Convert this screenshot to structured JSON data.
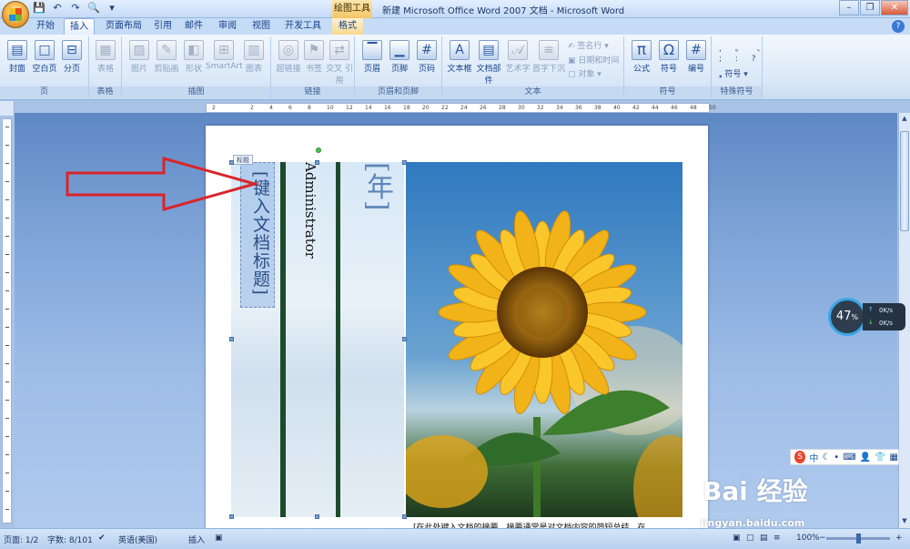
{
  "window": {
    "title": "新建 Microsoft Office Word 2007 文档 - Microsoft Word",
    "context_tab_title": "绘图工具"
  },
  "tabs": [
    {
      "label": "开始"
    },
    {
      "label": "插入",
      "active": true
    },
    {
      "label": "页面布局"
    },
    {
      "label": "引用"
    },
    {
      "label": "邮件"
    },
    {
      "label": "审阅"
    },
    {
      "label": "视图"
    },
    {
      "label": "开发工具"
    },
    {
      "label": "格式"
    }
  ],
  "ribbon": {
    "groups": {
      "page": "页",
      "table": "表格",
      "illustrations": "插图",
      "links": "链接",
      "header_footer": "页眉和页脚",
      "text": "文本",
      "symbols": "符号",
      "special_symbols": "特殊符号"
    },
    "buttons": {
      "cover": "封面",
      "blank_page": "空白页",
      "page_break": "分页",
      "table": "表格",
      "picture": "图片",
      "clip_art": "剪贴画",
      "shapes": "形状",
      "smartart": "SmartArt",
      "chart": "图表",
      "hyperlink": "超链接",
      "bookmark": "书签",
      "cross_ref": "交叉\n引用",
      "header": "页眉",
      "footer": "页脚",
      "page_number": "页码",
      "text_box": "文本框",
      "quick_parts": "文档部件",
      "wordart": "艺术字",
      "drop_cap": "首字下沉",
      "signature_line": "签名行",
      "date_time": "日期和时间",
      "object": "对象",
      "equation": "公式",
      "symbol": "符号",
      "number": "编号",
      "special_symbol": "符号"
    }
  },
  "ruler": {
    "ticks": [
      "2",
      "",
      "2",
      "4",
      "6",
      "8",
      "10",
      "12",
      "14",
      "16",
      "18",
      "20",
      "22",
      "24",
      "26",
      "28",
      "30",
      "32",
      "34",
      "36",
      "38",
      "40",
      "42",
      "44",
      "46",
      "48",
      "50"
    ]
  },
  "document": {
    "title_placeholder": "[键入文档标题]",
    "title_tag": "标题",
    "author": "Administrator",
    "year": "[年]",
    "abstract": "[在此处键入文档的摘要。摘要通常是对文档内容的简短总结。在"
  },
  "status": {
    "page": "页面: 1/2",
    "words": "字数: 8/101",
    "language": "英语(美国)",
    "mode": "插入",
    "zoom": "100%"
  },
  "overlays": {
    "speed_percent": "47",
    "speed_unit": "%",
    "upload": "0K/s",
    "download": "0K/s",
    "ime_lang": "中",
    "watermark_brand": "Bai  经验",
    "watermark_url": "jingyan.baidu.com"
  },
  "colors": {
    "ribbon_bg": "#dbe8f8",
    "title_color": "#2c4e86",
    "arrow": "#d9252a",
    "bar": "#1d4a2c"
  }
}
